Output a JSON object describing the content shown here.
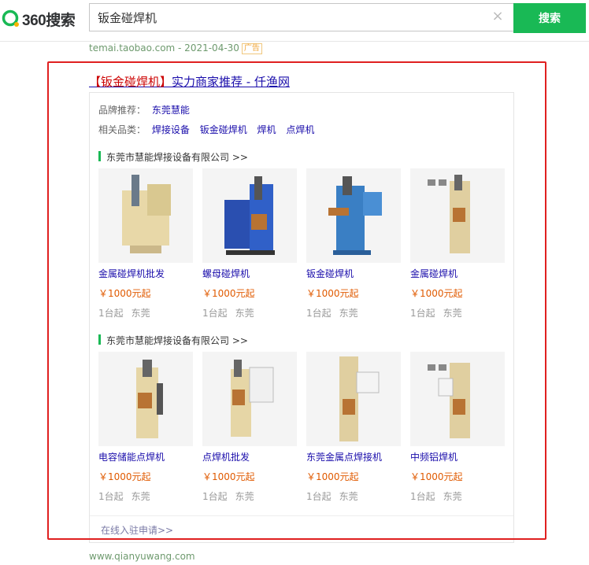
{
  "header": {
    "logo_text": "360搜索",
    "search_value": "钣金碰焊机",
    "search_button": "搜索",
    "clear_glyph": "×",
    "brand_color": "#19b955"
  },
  "source": {
    "url_date": "temai.taobao.com - 2021-04-30",
    "ad_label": "广告"
  },
  "result": {
    "title_highlight": "【钣金碰焊机】",
    "title_rest": "实力商家推荐 - 仟渔网",
    "brand_label": "品牌推荐：",
    "brand_value": "东莞慧能",
    "category_label": "相关品类：",
    "categories": [
      "焊接设备",
      "钣金碰焊机",
      "焊机",
      "点焊机"
    ],
    "groups": [
      {
        "company": "东莞市慧能焊接设备有限公司 >>",
        "products": [
          {
            "name": "金属碰焊机批发",
            "price": "￥1000元起",
            "moq": "1台起",
            "city": "东莞"
          },
          {
            "name": "螺母碰焊机",
            "price": "￥1000元起",
            "moq": "1台起",
            "city": "东莞"
          },
          {
            "name": "钣金碰焊机",
            "price": "￥1000元起",
            "moq": "1台起",
            "city": "东莞"
          },
          {
            "name": "金属碰焊机",
            "price": "￥1000元起",
            "moq": "1台起",
            "city": "东莞"
          }
        ]
      },
      {
        "company": "东莞市慧能焊接设备有限公司 >>",
        "products": [
          {
            "name": "电容储能点焊机",
            "price": "￥1000元起",
            "moq": "1台起",
            "city": "东莞"
          },
          {
            "name": "点焊机批发",
            "price": "￥1000元起",
            "moq": "1台起",
            "city": "东莞"
          },
          {
            "name": "东莞金属点焊接机",
            "price": "￥1000元起",
            "moq": "1台起",
            "city": "东莞"
          },
          {
            "name": "中频铝焊机",
            "price": "￥1000元起",
            "moq": "1台起",
            "city": "东莞"
          }
        ]
      }
    ],
    "apply_link": "在线入驻申请>>",
    "footer_url": "www.qianyuwang.com"
  }
}
